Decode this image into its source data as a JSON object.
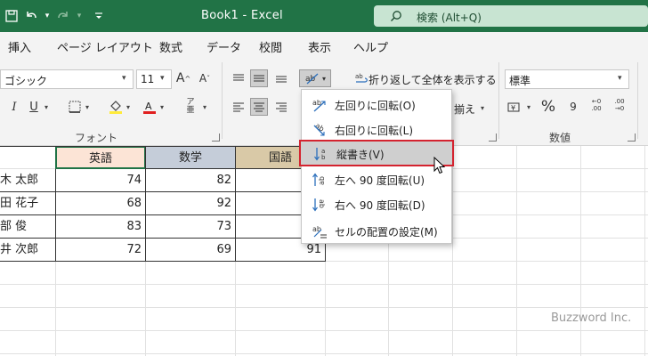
{
  "titlebar": {
    "title": "Book1  -  Excel",
    "search_placeholder": "検索 (Alt+Q)",
    "bg": "#217346"
  },
  "menu": {
    "tabs": [
      "挿入",
      "ページ レイアウト",
      "数式",
      "データ",
      "校閲",
      "表示",
      "ヘルプ"
    ]
  },
  "ribbon": {
    "font_name": "ゴシック",
    "font_size": "11",
    "wrap_text_label": "折り返して全体を表示する",
    "align_partial_label": "揃え",
    "number_format": "標準",
    "group_font": "フォント",
    "group_number": "数値"
  },
  "orientation_menu": {
    "items": [
      {
        "label": "左回りに回転(O)",
        "icon": "rotate-ccw-icon"
      },
      {
        "label": "右回りに回転(L)",
        "icon": "rotate-cw-icon"
      },
      {
        "label": "縦書き(V)",
        "icon": "vertical-text-icon"
      },
      {
        "label": "左へ 90 度回転(U)",
        "icon": "rotate-up-icon"
      },
      {
        "label": "右へ 90 度回転(D)",
        "icon": "rotate-down-icon"
      },
      {
        "label": "セルの配置の設定(M)",
        "icon": "format-cell-alignment-icon"
      }
    ],
    "highlighted": "縦書き(V)",
    "highlight_color": "#d4232f"
  },
  "table": {
    "headers": [
      "英語",
      "数学",
      "国語"
    ],
    "header_colors": [
      "#fce4d6",
      "#c5cdd9",
      "#d9c9a7"
    ],
    "rows": [
      {
        "name": "木 太郎",
        "values": [
          "74",
          "82",
          ""
        ]
      },
      {
        "name": "田 花子",
        "values": [
          "68",
          "92",
          ""
        ]
      },
      {
        "name": "部 俊",
        "values": [
          "83",
          "73",
          ""
        ]
      },
      {
        "name": "井 次郎",
        "values": [
          "72",
          "69",
          "91"
        ]
      }
    ]
  },
  "watermark": "Buzzword Inc."
}
